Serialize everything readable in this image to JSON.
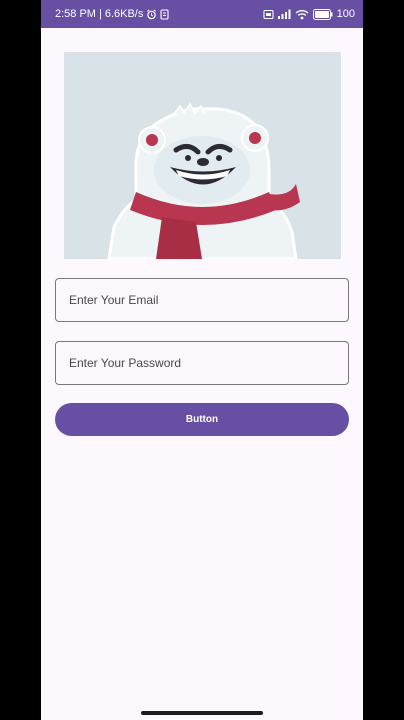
{
  "statusbar": {
    "time": "2:58 PM",
    "separator": "|",
    "net_speed": "6.6KB/s",
    "battery": "100"
  },
  "form": {
    "email_placeholder": "Enter Your Email",
    "password_placeholder": "Enter Your Password",
    "button_label": "Button"
  },
  "colors": {
    "primary": "#6750a4",
    "background": "#fdf8fd",
    "outline": "#7a757f"
  }
}
